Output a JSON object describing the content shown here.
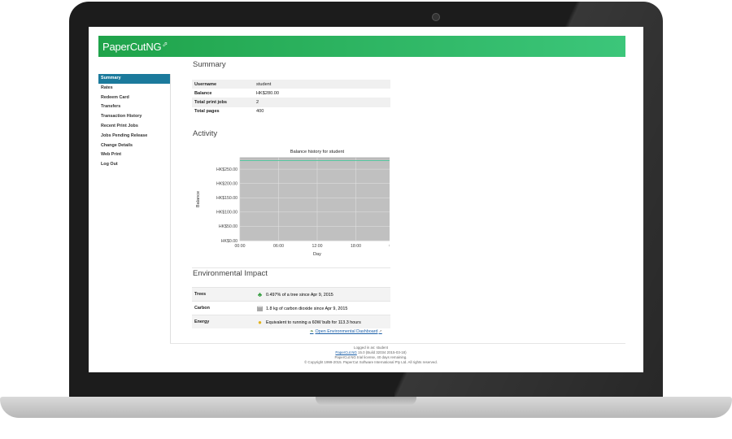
{
  "app": {
    "logo_text": "PaperCut",
    "logo_suffix": "NG"
  },
  "colors": {
    "header_start": "#1fa34a",
    "header_end": "#3cc67a",
    "nav_active": "#1b7a9c",
    "chart_bg": "#c0c0c0",
    "chart_line": "#57c6a0"
  },
  "sidebar": {
    "items": [
      {
        "label": "Summary",
        "active": true
      },
      {
        "label": "Rates",
        "active": false
      },
      {
        "label": "Redeem Card",
        "active": false
      },
      {
        "label": "Transfers",
        "active": false
      },
      {
        "label": "Transaction History",
        "active": false
      },
      {
        "label": "Recent Print Jobs",
        "active": false
      },
      {
        "label": "Jobs Pending Release",
        "active": false
      },
      {
        "label": "Change Details",
        "active": false
      },
      {
        "label": "Web Print",
        "active": false
      },
      {
        "label": "Log Out",
        "active": false
      }
    ]
  },
  "summary": {
    "title": "Summary",
    "rows": [
      {
        "key": "Username",
        "value": "student"
      },
      {
        "key": "Balance",
        "value": "HK$280.00"
      },
      {
        "key": "Total print jobs",
        "value": "2"
      },
      {
        "key": "Total pages",
        "value": "400"
      }
    ]
  },
  "activity": {
    "title": "Activity"
  },
  "chart_data": {
    "type": "line",
    "title": "Balance history for student",
    "xlabel": "Day",
    "ylabel": "Balance",
    "x_ticks": [
      "00:00",
      "06:00",
      "12:00",
      "18:00",
      "00:00"
    ],
    "y_ticks": [
      "HK$0.00",
      "HK$50.00",
      "HK$100.00",
      "HK$150.00",
      "HK$200.00",
      "HK$250.00"
    ],
    "y_tick_values": [
      0,
      50,
      100,
      150,
      200,
      250
    ],
    "ylim": [
      0,
      290
    ],
    "x": [
      0,
      24
    ],
    "series": [
      {
        "values": [
          280,
          280
        ]
      }
    ],
    "grid": true
  },
  "environment": {
    "title": "Environmental Impact",
    "rows": [
      {
        "key": "Trees",
        "icon": "tree-icon",
        "value": "0.497% of a tree since Apr 9, 2015"
      },
      {
        "key": "Carbon",
        "icon": "carbon-icon",
        "value": "1.8 kg of carbon dioxide since Apr 9, 2015"
      },
      {
        "key": "Energy",
        "icon": "bulb-icon",
        "value": "Equivalent to running a 60W bulb for 113.3 hours"
      }
    ],
    "dashboard_link": "Open Environmental Dashboard"
  },
  "footer": {
    "logged_in": "Logged in as: student",
    "version_link": "PaperCut NG",
    "version_rest": "15.0 (Build 32034 2015-03-18)",
    "trial": "PaperCut NG trial license, 40 days remaining.",
    "copyright": "© Copyright 1999-2015. PaperCut Software International Pty Ltd. All rights reserved."
  }
}
